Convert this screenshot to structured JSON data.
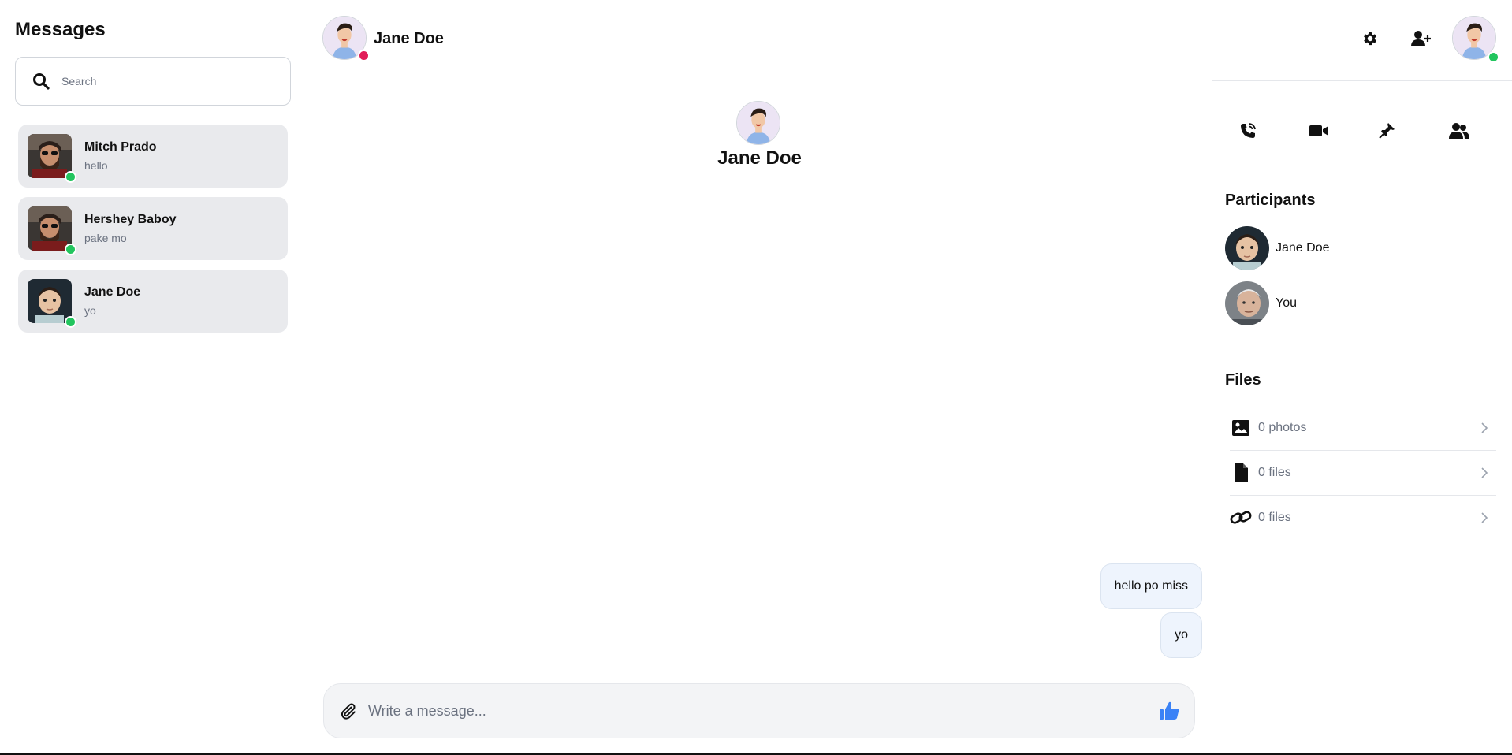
{
  "colors": {
    "online": "#22c55e",
    "busy": "#e11d58",
    "accent": "#3b82f6"
  },
  "sidebar": {
    "title": "Messages",
    "search": {
      "placeholder": "Search",
      "icon": "search-icon"
    },
    "conversations": [
      {
        "name": "Mitch Prado",
        "preview": "hello",
        "status": "online"
      },
      {
        "name": "Hershey Baboy",
        "preview": "pake mo",
        "status": "online"
      },
      {
        "name": "Jane Doe",
        "preview": "yo",
        "status": "online"
      }
    ]
  },
  "header": {
    "contact_name": "Jane Doe",
    "icons": [
      "gear-icon",
      "add-user-icon"
    ]
  },
  "chat": {
    "intro_name": "Jane Doe",
    "messages": [
      {
        "text": "hello po miss",
        "from": "me"
      },
      {
        "text": "yo",
        "from": "me"
      }
    ],
    "composer": {
      "placeholder": "Write a message...",
      "attach_icon": "paperclip-icon",
      "send_icon": "thumbs-up-icon"
    }
  },
  "info": {
    "actions": [
      "phone-call-icon",
      "video-camera-icon",
      "pin-icon",
      "users-icon"
    ],
    "participants_title": "Participants",
    "participants": [
      {
        "name": "Jane Doe"
      },
      {
        "name": "You"
      }
    ],
    "files_title": "Files",
    "files": [
      {
        "label": "0 photos",
        "icon": "image-icon"
      },
      {
        "label": "0 files",
        "icon": "file-icon"
      },
      {
        "label": "0 files",
        "icon": "link-icon"
      }
    ]
  }
}
